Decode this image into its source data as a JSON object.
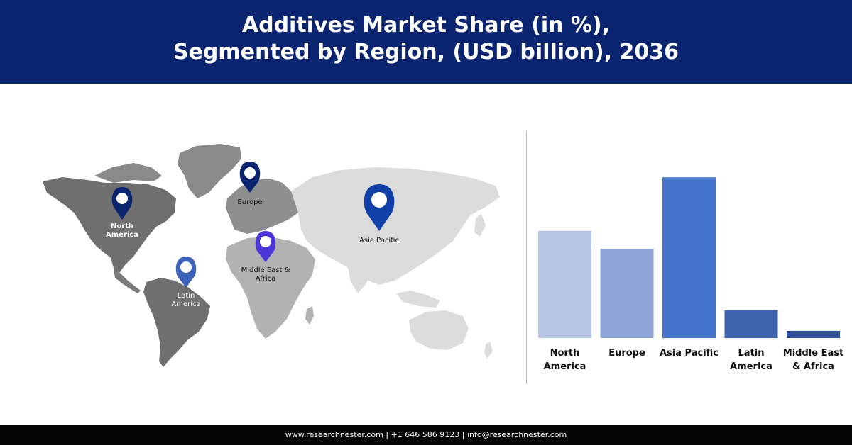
{
  "header": {
    "title_line1": "Additives Market Share (in %),",
    "title_line2": "Segmented by Region, (USD billion), 2036",
    "bg_color": "#0b2470"
  },
  "map": {
    "pins": [
      {
        "id": "north-america",
        "label_lines": [
          "North",
          "America"
        ],
        "color": "#0b2470"
      },
      {
        "id": "europe",
        "label_lines": [
          "Europe"
        ],
        "color": "#0b2470"
      },
      {
        "id": "asia-pacific",
        "label_lines": [
          "Asia Pacific"
        ],
        "color": "#1140a8"
      },
      {
        "id": "middle-east-africa",
        "label_lines": [
          "Middle East &",
          "Africa"
        ],
        "color": "#4a36d9"
      },
      {
        "id": "latin-america",
        "label_lines": [
          "Latin",
          "America"
        ],
        "color": "#3c62b8"
      }
    ]
  },
  "chart_data": {
    "type": "bar",
    "categories": [
      "North America",
      "Europe",
      "Asia Pacific",
      "Latin America",
      "Middle East & Africa"
    ],
    "category_label_lines": [
      [
        "North",
        "America"
      ],
      [
        "Europe"
      ],
      [
        "Asia Pacific"
      ],
      [
        "Latin",
        "America"
      ],
      [
        "Middle East",
        "& Africa"
      ]
    ],
    "values": [
      27,
      22.5,
      40.5,
      7,
      1.8
    ],
    "colors": [
      "#b8c6e6",
      "#8fa4d6",
      "#4574cc",
      "#3e63ac",
      "#2f4f9b"
    ],
    "ylim": [
      0,
      45
    ],
    "title": "",
    "xlabel": "",
    "ylabel": "",
    "grid": false,
    "legend": "none"
  },
  "footer": {
    "text": "www.researchnester.com  | +1 646 586 9123 | info@researchnester.com"
  }
}
